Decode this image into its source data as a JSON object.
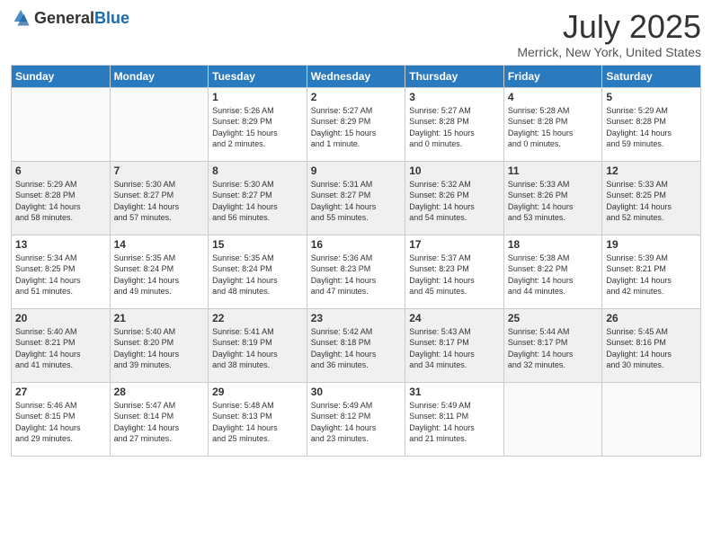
{
  "header": {
    "logo_general": "General",
    "logo_blue": "Blue",
    "title": "July 2025",
    "location": "Merrick, New York, United States"
  },
  "weekdays": [
    "Sunday",
    "Monday",
    "Tuesday",
    "Wednesday",
    "Thursday",
    "Friday",
    "Saturday"
  ],
  "weeks": [
    [
      {
        "day": "",
        "info": ""
      },
      {
        "day": "",
        "info": ""
      },
      {
        "day": "1",
        "info": "Sunrise: 5:26 AM\nSunset: 8:29 PM\nDaylight: 15 hours\nand 2 minutes."
      },
      {
        "day": "2",
        "info": "Sunrise: 5:27 AM\nSunset: 8:29 PM\nDaylight: 15 hours\nand 1 minute."
      },
      {
        "day": "3",
        "info": "Sunrise: 5:27 AM\nSunset: 8:28 PM\nDaylight: 15 hours\nand 0 minutes."
      },
      {
        "day": "4",
        "info": "Sunrise: 5:28 AM\nSunset: 8:28 PM\nDaylight: 15 hours\nand 0 minutes."
      },
      {
        "day": "5",
        "info": "Sunrise: 5:29 AM\nSunset: 8:28 PM\nDaylight: 14 hours\nand 59 minutes."
      }
    ],
    [
      {
        "day": "6",
        "info": "Sunrise: 5:29 AM\nSunset: 8:28 PM\nDaylight: 14 hours\nand 58 minutes."
      },
      {
        "day": "7",
        "info": "Sunrise: 5:30 AM\nSunset: 8:27 PM\nDaylight: 14 hours\nand 57 minutes."
      },
      {
        "day": "8",
        "info": "Sunrise: 5:30 AM\nSunset: 8:27 PM\nDaylight: 14 hours\nand 56 minutes."
      },
      {
        "day": "9",
        "info": "Sunrise: 5:31 AM\nSunset: 8:27 PM\nDaylight: 14 hours\nand 55 minutes."
      },
      {
        "day": "10",
        "info": "Sunrise: 5:32 AM\nSunset: 8:26 PM\nDaylight: 14 hours\nand 54 minutes."
      },
      {
        "day": "11",
        "info": "Sunrise: 5:33 AM\nSunset: 8:26 PM\nDaylight: 14 hours\nand 53 minutes."
      },
      {
        "day": "12",
        "info": "Sunrise: 5:33 AM\nSunset: 8:25 PM\nDaylight: 14 hours\nand 52 minutes."
      }
    ],
    [
      {
        "day": "13",
        "info": "Sunrise: 5:34 AM\nSunset: 8:25 PM\nDaylight: 14 hours\nand 51 minutes."
      },
      {
        "day": "14",
        "info": "Sunrise: 5:35 AM\nSunset: 8:24 PM\nDaylight: 14 hours\nand 49 minutes."
      },
      {
        "day": "15",
        "info": "Sunrise: 5:35 AM\nSunset: 8:24 PM\nDaylight: 14 hours\nand 48 minutes."
      },
      {
        "day": "16",
        "info": "Sunrise: 5:36 AM\nSunset: 8:23 PM\nDaylight: 14 hours\nand 47 minutes."
      },
      {
        "day": "17",
        "info": "Sunrise: 5:37 AM\nSunset: 8:23 PM\nDaylight: 14 hours\nand 45 minutes."
      },
      {
        "day": "18",
        "info": "Sunrise: 5:38 AM\nSunset: 8:22 PM\nDaylight: 14 hours\nand 44 minutes."
      },
      {
        "day": "19",
        "info": "Sunrise: 5:39 AM\nSunset: 8:21 PM\nDaylight: 14 hours\nand 42 minutes."
      }
    ],
    [
      {
        "day": "20",
        "info": "Sunrise: 5:40 AM\nSunset: 8:21 PM\nDaylight: 14 hours\nand 41 minutes."
      },
      {
        "day": "21",
        "info": "Sunrise: 5:40 AM\nSunset: 8:20 PM\nDaylight: 14 hours\nand 39 minutes."
      },
      {
        "day": "22",
        "info": "Sunrise: 5:41 AM\nSunset: 8:19 PM\nDaylight: 14 hours\nand 38 minutes."
      },
      {
        "day": "23",
        "info": "Sunrise: 5:42 AM\nSunset: 8:18 PM\nDaylight: 14 hours\nand 36 minutes."
      },
      {
        "day": "24",
        "info": "Sunrise: 5:43 AM\nSunset: 8:17 PM\nDaylight: 14 hours\nand 34 minutes."
      },
      {
        "day": "25",
        "info": "Sunrise: 5:44 AM\nSunset: 8:17 PM\nDaylight: 14 hours\nand 32 minutes."
      },
      {
        "day": "26",
        "info": "Sunrise: 5:45 AM\nSunset: 8:16 PM\nDaylight: 14 hours\nand 30 minutes."
      }
    ],
    [
      {
        "day": "27",
        "info": "Sunrise: 5:46 AM\nSunset: 8:15 PM\nDaylight: 14 hours\nand 29 minutes."
      },
      {
        "day": "28",
        "info": "Sunrise: 5:47 AM\nSunset: 8:14 PM\nDaylight: 14 hours\nand 27 minutes."
      },
      {
        "day": "29",
        "info": "Sunrise: 5:48 AM\nSunset: 8:13 PM\nDaylight: 14 hours\nand 25 minutes."
      },
      {
        "day": "30",
        "info": "Sunrise: 5:49 AM\nSunset: 8:12 PM\nDaylight: 14 hours\nand 23 minutes."
      },
      {
        "day": "31",
        "info": "Sunrise: 5:49 AM\nSunset: 8:11 PM\nDaylight: 14 hours\nand 21 minutes."
      },
      {
        "day": "",
        "info": ""
      },
      {
        "day": "",
        "info": ""
      }
    ]
  ]
}
